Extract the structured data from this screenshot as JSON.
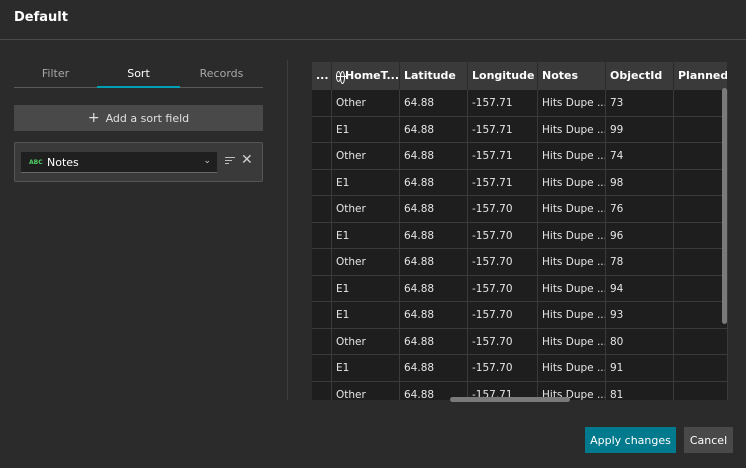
{
  "window": {
    "title": "Default"
  },
  "tabs": [
    {
      "label": "Filter"
    },
    {
      "label": "Sort"
    },
    {
      "label": "Records"
    }
  ],
  "active_tab": "Sort",
  "sort_panel": {
    "add_label": "Add a sort field",
    "field": {
      "type_badge": "ABC",
      "label": "Notes"
    }
  },
  "table": {
    "columns": [
      "...",
      "HomeT...",
      "Latitude",
      "Longitude",
      "Notes",
      "ObjectId",
      "Planned ..."
    ],
    "rows": [
      [
        "",
        "Other",
        "64.88",
        "-157.71",
        "Hits Dupe ...",
        "73",
        ""
      ],
      [
        "",
        "E1",
        "64.88",
        "-157.71",
        "Hits Dupe ...",
        "99",
        ""
      ],
      [
        "",
        "Other",
        "64.88",
        "-157.71",
        "Hits Dupe ...",
        "74",
        ""
      ],
      [
        "",
        "E1",
        "64.88",
        "-157.71",
        "Hits Dupe ...",
        "98",
        ""
      ],
      [
        "",
        "Other",
        "64.88",
        "-157.70",
        "Hits Dupe ...",
        "76",
        ""
      ],
      [
        "",
        "E1",
        "64.88",
        "-157.70",
        "Hits Dupe ...",
        "96",
        ""
      ],
      [
        "",
        "Other",
        "64.88",
        "-157.70",
        "Hits Dupe ...",
        "78",
        ""
      ],
      [
        "",
        "E1",
        "64.88",
        "-157.70",
        "Hits Dupe ...",
        "94",
        ""
      ],
      [
        "",
        "E1",
        "64.88",
        "-157.70",
        "Hits Dupe ...",
        "93",
        ""
      ],
      [
        "",
        "Other",
        "64.88",
        "-157.70",
        "Hits Dupe ...",
        "80",
        ""
      ],
      [
        "",
        "E1",
        "64.88",
        "-157.70",
        "Hits Dupe ...",
        "91",
        ""
      ],
      [
        "",
        "Other",
        "64.88",
        "-157.71",
        "Hits Dupe ...",
        "81",
        ""
      ]
    ]
  },
  "footer": {
    "apply_label": "Apply changes",
    "cancel_label": "Cancel"
  },
  "colors": {
    "accent": "#00a0b4",
    "apply": "#007a8c",
    "text_type": "#4ed063"
  },
  "icons": {
    "add": "plus-icon",
    "field_type": "text-type-icon",
    "dropdown": "chevron-down-icon",
    "sort_direction": "sort-descending-icon",
    "remove": "close-icon",
    "column_type": "globe-icon"
  }
}
